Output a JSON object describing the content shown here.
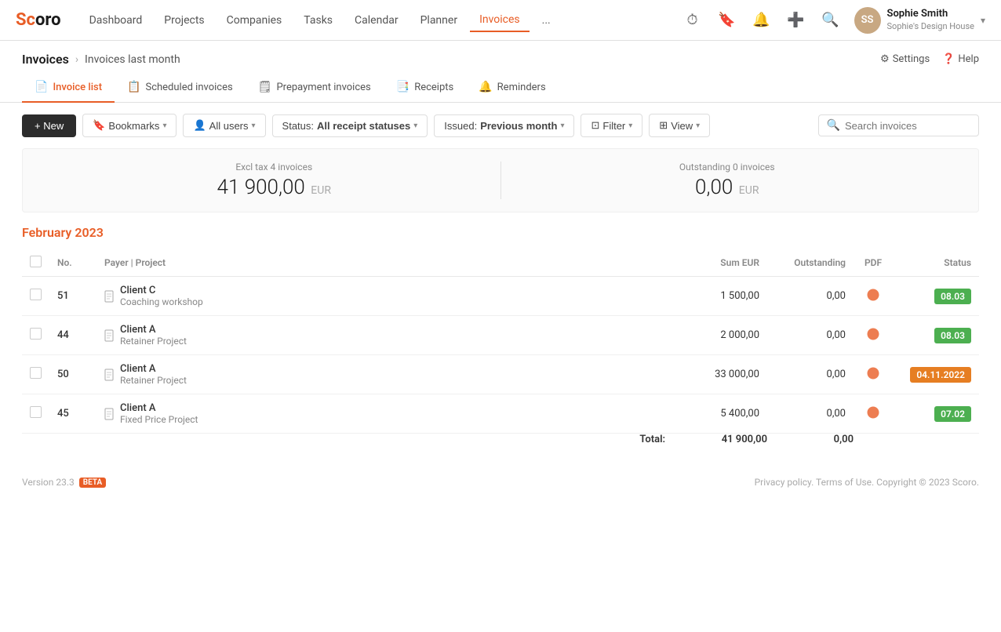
{
  "nav": {
    "logo": "Scoro",
    "links": [
      {
        "label": "Dashboard",
        "active": false
      },
      {
        "label": "Projects",
        "active": false
      },
      {
        "label": "Companies",
        "active": false
      },
      {
        "label": "Tasks",
        "active": false
      },
      {
        "label": "Calendar",
        "active": false
      },
      {
        "label": "Planner",
        "active": false
      },
      {
        "label": "Invoices",
        "active": true
      },
      {
        "label": "...",
        "active": false
      }
    ],
    "user": {
      "name": "Sophie Smith",
      "company": "Sophie's Design House",
      "initials": "SS"
    }
  },
  "page": {
    "breadcrumb_root": "Invoices",
    "breadcrumb_current": "Invoices last month",
    "settings_label": "Settings",
    "help_label": "Help"
  },
  "tabs": [
    {
      "label": "Invoice list",
      "active": true,
      "icon": "📄"
    },
    {
      "label": "Scheduled invoices",
      "active": false,
      "icon": "📋"
    },
    {
      "label": "Prepayment invoices",
      "active": false,
      "icon": "🗒"
    },
    {
      "label": "Receipts",
      "active": false,
      "icon": "📑"
    },
    {
      "label": "Reminders",
      "active": false,
      "icon": "🔔"
    }
  ],
  "toolbar": {
    "new_label": "+ New",
    "bookmarks_label": "Bookmarks",
    "all_users_label": "All users",
    "status_label": "Status:",
    "status_value": "All receipt statuses",
    "issued_label": "Issued:",
    "issued_value": "Previous month",
    "filter_label": "Filter",
    "view_label": "View",
    "search_placeholder": "Search invoices"
  },
  "summary": {
    "left_label": "Excl tax 4 invoices",
    "left_amount": "41 900,00",
    "left_currency": "EUR",
    "right_label": "Outstanding 0 invoices",
    "right_amount": "0,00",
    "right_currency": "EUR"
  },
  "table": {
    "month_heading": "February 2023",
    "columns": [
      "",
      "No.",
      "Payer | Project",
      "Sum EUR",
      "Outstanding",
      "PDF",
      "Status"
    ],
    "rows": [
      {
        "no": "51",
        "payer": "Client C",
        "project": "Coaching workshop",
        "sum": "1 500,00",
        "outstanding": "0,00",
        "status": "08.03",
        "status_color": "green"
      },
      {
        "no": "44",
        "payer": "Client A",
        "project": "Retainer Project",
        "sum": "2 000,00",
        "outstanding": "0,00",
        "status": "08.03",
        "status_color": "green"
      },
      {
        "no": "50",
        "payer": "Client A",
        "project": "Retainer Project",
        "sum": "33 000,00",
        "outstanding": "0,00",
        "status": "04.11.2022",
        "status_color": "orange"
      },
      {
        "no": "45",
        "payer": "Client A",
        "project": "Fixed Price Project",
        "sum": "5 400,00",
        "outstanding": "0,00",
        "status": "07.02",
        "status_color": "green"
      }
    ],
    "total_label": "Total:",
    "total_sum": "41 900,00",
    "total_outstanding": "0,00"
  },
  "footer": {
    "version": "Version 23.3",
    "beta": "BETA",
    "copyright": "Privacy policy. Terms of Use. Copyright © 2023 Scoro."
  }
}
